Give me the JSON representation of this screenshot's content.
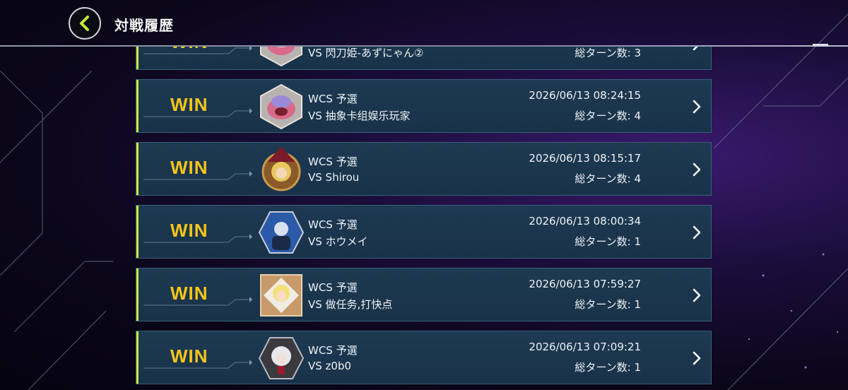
{
  "header": {
    "title": "対戦履歴"
  },
  "icons": {
    "back": "chevron-left-icon",
    "row_arrow": "chevron-right-icon"
  },
  "colors": {
    "accent": "#c8e63a",
    "win": "#f5c518",
    "row_bg": "#1b3850"
  },
  "rows": [
    {
      "result": "WIN",
      "event": "",
      "opponent": "VS 閃刀姫-あずにゃん②",
      "date": "",
      "turns": "総ターン数: 3",
      "avatar": "cake-monster-avatar"
    },
    {
      "result": "WIN",
      "event": "WCS 予選",
      "opponent": "VS 抽象卡组娱乐玩家",
      "date": "2026/06/13 08:24:15",
      "turns": "総ターン数: 4",
      "avatar": "cake-monster-avatar"
    },
    {
      "result": "WIN",
      "event": "WCS 予選",
      "opponent": "VS Shirou",
      "date": "2026/06/13 08:15:17",
      "turns": "総ターン数: 4",
      "avatar": "witch-avatar"
    },
    {
      "result": "WIN",
      "event": "WCS 予選",
      "opponent": "VS ホウメイ",
      "date": "2026/06/13 08:00:34",
      "turns": "総ターン数: 1",
      "avatar": "blue-hex-avatar"
    },
    {
      "result": "WIN",
      "event": "WCS 予選",
      "opponent": "VS 做任务,打快点",
      "date": "2026/06/13 07:59:27",
      "turns": "総ターン数: 1",
      "avatar": "blonde-girl-avatar"
    },
    {
      "result": "WIN",
      "event": "WCS 予選",
      "opponent": "VS z0b0",
      "date": "2026/06/13 07:09:21",
      "turns": "総ターン数: 1",
      "avatar": "white-hair-avatar"
    }
  ]
}
